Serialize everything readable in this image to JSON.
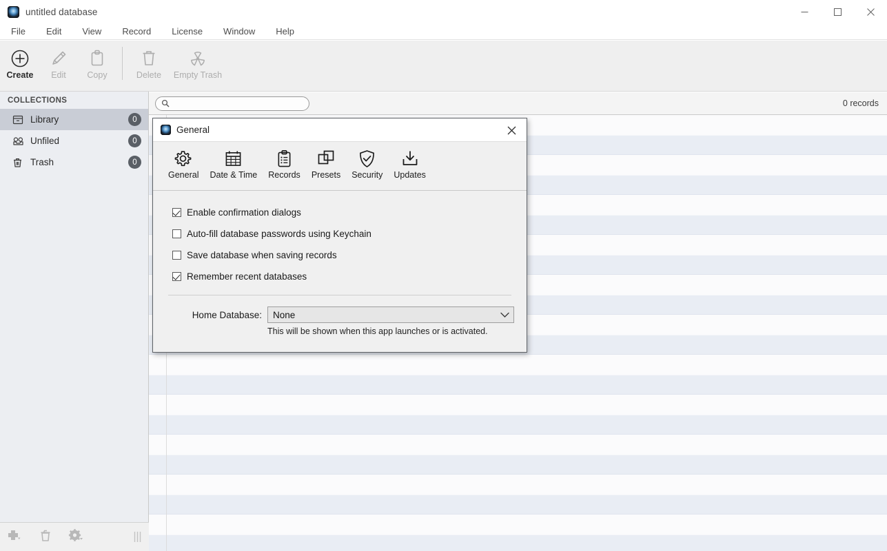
{
  "window": {
    "title": "untitled database",
    "app_icon": "app-globe-icon",
    "controls": [
      {
        "name": "minimize",
        "glyph": "minimize-icon"
      },
      {
        "name": "maximize",
        "glyph": "maximize-icon"
      },
      {
        "name": "close",
        "glyph": "close-icon"
      }
    ]
  },
  "menubar": {
    "items": [
      {
        "label": "File"
      },
      {
        "label": "Edit"
      },
      {
        "label": "View"
      },
      {
        "label": "Record"
      },
      {
        "label": "License"
      },
      {
        "label": "Window"
      },
      {
        "label": "Help"
      }
    ]
  },
  "toolbar": {
    "buttons": [
      {
        "label": "Create",
        "icon": "plus-circle-icon",
        "enabled": true
      },
      {
        "label": "Edit",
        "icon": "pencil-icon",
        "enabled": false
      },
      {
        "label": "Copy",
        "icon": "clipboard-copy-icon",
        "enabled": false
      },
      {
        "label": "Delete",
        "icon": "trash-icon",
        "enabled": false
      },
      {
        "label": "Empty Trash",
        "icon": "radiation-icon",
        "enabled": false
      }
    ]
  },
  "search": {
    "value": "",
    "placeholder": "",
    "icon": "search-icon"
  },
  "status": {
    "records_count": "0 records"
  },
  "sidebar": {
    "header": "COLLECTIONS",
    "items": [
      {
        "label": "Library",
        "count": "0",
        "icon": "library-box-icon",
        "selected": true
      },
      {
        "label": "Unfiled",
        "count": "0",
        "icon": "unfiled-inbox-icon",
        "selected": false
      },
      {
        "label": "Trash",
        "count": "0",
        "icon": "trash-icon",
        "selected": false
      }
    ],
    "footer_buttons": [
      {
        "name": "add-collection-button",
        "icon": "plus-dropdown-icon"
      },
      {
        "name": "delete-collection-button",
        "icon": "trash-icon"
      },
      {
        "name": "collection-actions-button",
        "icon": "gear-dropdown-icon"
      }
    ],
    "resize_grip": "grip-icon"
  },
  "table": {
    "row_count": 22,
    "colors": {
      "odd": "#fbfbfc",
      "even": "#e9edf4"
    }
  },
  "dialog": {
    "title": "General",
    "icon": "app-globe-icon",
    "close_label": "close-icon",
    "tabs": [
      {
        "label": "General",
        "icon": "gear-icon",
        "active": true
      },
      {
        "label": "Date & Time",
        "icon": "calendar-icon",
        "active": false
      },
      {
        "label": "Records",
        "icon": "clipboard-list-icon",
        "active": false
      },
      {
        "label": "Presets",
        "icon": "layers-copy-icon",
        "active": false
      },
      {
        "label": "Security",
        "icon": "shield-check-icon",
        "active": false
      },
      {
        "label": "Updates",
        "icon": "download-tray-icon",
        "active": false
      }
    ],
    "checkboxes": [
      {
        "label": "Enable confirmation dialogs",
        "checked": true
      },
      {
        "label": "Auto-fill database passwords using Keychain",
        "checked": false
      },
      {
        "label": "Save database when saving records",
        "checked": false
      },
      {
        "label": "Remember recent databases",
        "checked": true
      }
    ],
    "home_database": {
      "label": "Home Database:",
      "value": "None",
      "options": [
        "None"
      ],
      "hint": "This will be shown when this app launches or is activated."
    }
  },
  "colors": {
    "sidebar_bg": "#eceef2",
    "selection": "#c9cdd6",
    "toolbar_bg": "#efefef",
    "dialog_bg": "#f0f0f0",
    "badge_bg": "#5a5f66",
    "row_alt": "#e9edf4"
  }
}
